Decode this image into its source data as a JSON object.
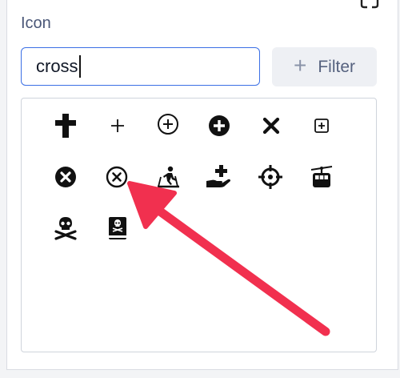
{
  "field": {
    "label": "Icon",
    "search_value": "cross",
    "filter_label": "Filter"
  },
  "icons": [
    {
      "name": "cross-icon"
    },
    {
      "name": "plus-icon"
    },
    {
      "name": "plus-circle-outline-icon"
    },
    {
      "name": "plus-circle-filled-icon"
    },
    {
      "name": "x-mark-icon"
    },
    {
      "name": "plus-square-icon"
    },
    {
      "name": "x-circle-filled-icon"
    },
    {
      "name": "x-circle-outline-icon"
    },
    {
      "name": "skiing-nordic-icon"
    },
    {
      "name": "hand-holding-medical-icon"
    },
    {
      "name": "crosshairs-icon"
    },
    {
      "name": "cable-car-icon"
    },
    {
      "name": "skull-crossbones-icon"
    },
    {
      "name": "book-dead-icon"
    }
  ],
  "colors": {
    "accent": "#3b6fe5",
    "arrow": "#f1304f",
    "icon": "#111111"
  }
}
